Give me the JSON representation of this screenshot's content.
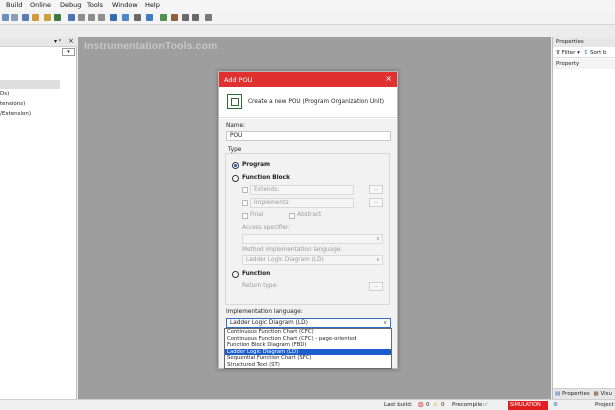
{
  "menu": [
    "Build",
    "Online",
    "Debug",
    "Tools",
    "Window",
    "Help"
  ],
  "left_panel": {
    "lines": [
      "Ds)",
      "tensions)",
      "/Extension)"
    ]
  },
  "watermark": "InstrumentationTools.com",
  "properties_panel": {
    "title": "Properties",
    "filter": "Filter",
    "sort": "Sort b",
    "item": "Property",
    "footer_tab1": "Properties",
    "footer_tab2": "Visu"
  },
  "status": {
    "last_build": "Last build:",
    "errors": "0",
    "warnings": "0",
    "precompile": "Precompile:",
    "simulation": "SIMULATION",
    "project": "Project"
  },
  "dialog": {
    "title": "Add POU",
    "description": "Create a new POU (Program Organization Unit)",
    "name_label": "Name:",
    "name_value": "POU",
    "type_label": "Type",
    "program": "Program",
    "function_block": "Function Block",
    "extends": "Extends:",
    "implements": "Implements:",
    "final": "Final",
    "abstract": "Abstract",
    "access_specifier": "Access specifier:",
    "method_impl_label": "Method implementation language:",
    "method_impl_value": "Ladder Logic Diagram (LD)",
    "function": "Function",
    "return_type": "Return type:",
    "ellipsis": "...",
    "impl_label": "Implementation language:",
    "impl_value": "Ladder Logic Diagram (LD)",
    "options": [
      "Continuous Function Chart (CFC)",
      "Continuous Function Chart (CFC) - page-oriented",
      "Function Block Diagram (FBD)",
      "Ladder Logic Diagram (LD)",
      "Sequential Function Chart (SFC)",
      "Structured Text (ST)"
    ],
    "selected_option": "Ladder Logic Diagram (LD)"
  },
  "colors": {
    "accent_red": "#e03131",
    "selection_blue": "#1b5ec9"
  }
}
